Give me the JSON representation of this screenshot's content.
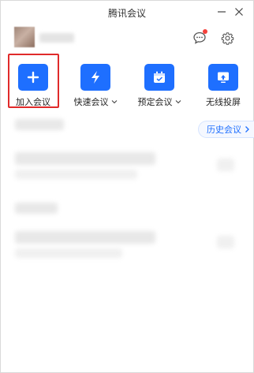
{
  "window": {
    "title": "腾讯会议",
    "minimize_icon": "minus-icon",
    "close_icon": "close-icon"
  },
  "header": {
    "chat_icon": "chat-bubble-icon",
    "settings_icon": "gear-icon",
    "notification_dot_color": "#f5413b"
  },
  "actions": [
    {
      "label": "加入会议",
      "icon": "plus-icon",
      "dropdown": false,
      "highlighted": true
    },
    {
      "label": "快速会议",
      "icon": "lightning-icon",
      "dropdown": true,
      "highlighted": false
    },
    {
      "label": "预定会议",
      "icon": "calendar-icon",
      "dropdown": true,
      "highlighted": false
    },
    {
      "label": "无线投屏",
      "icon": "screen-cast-icon",
      "dropdown": false,
      "highlighted": false
    }
  ],
  "history": {
    "label": "历史会议"
  },
  "colors": {
    "accent": "#1e6fff",
    "highlight": "#e02a2a"
  }
}
